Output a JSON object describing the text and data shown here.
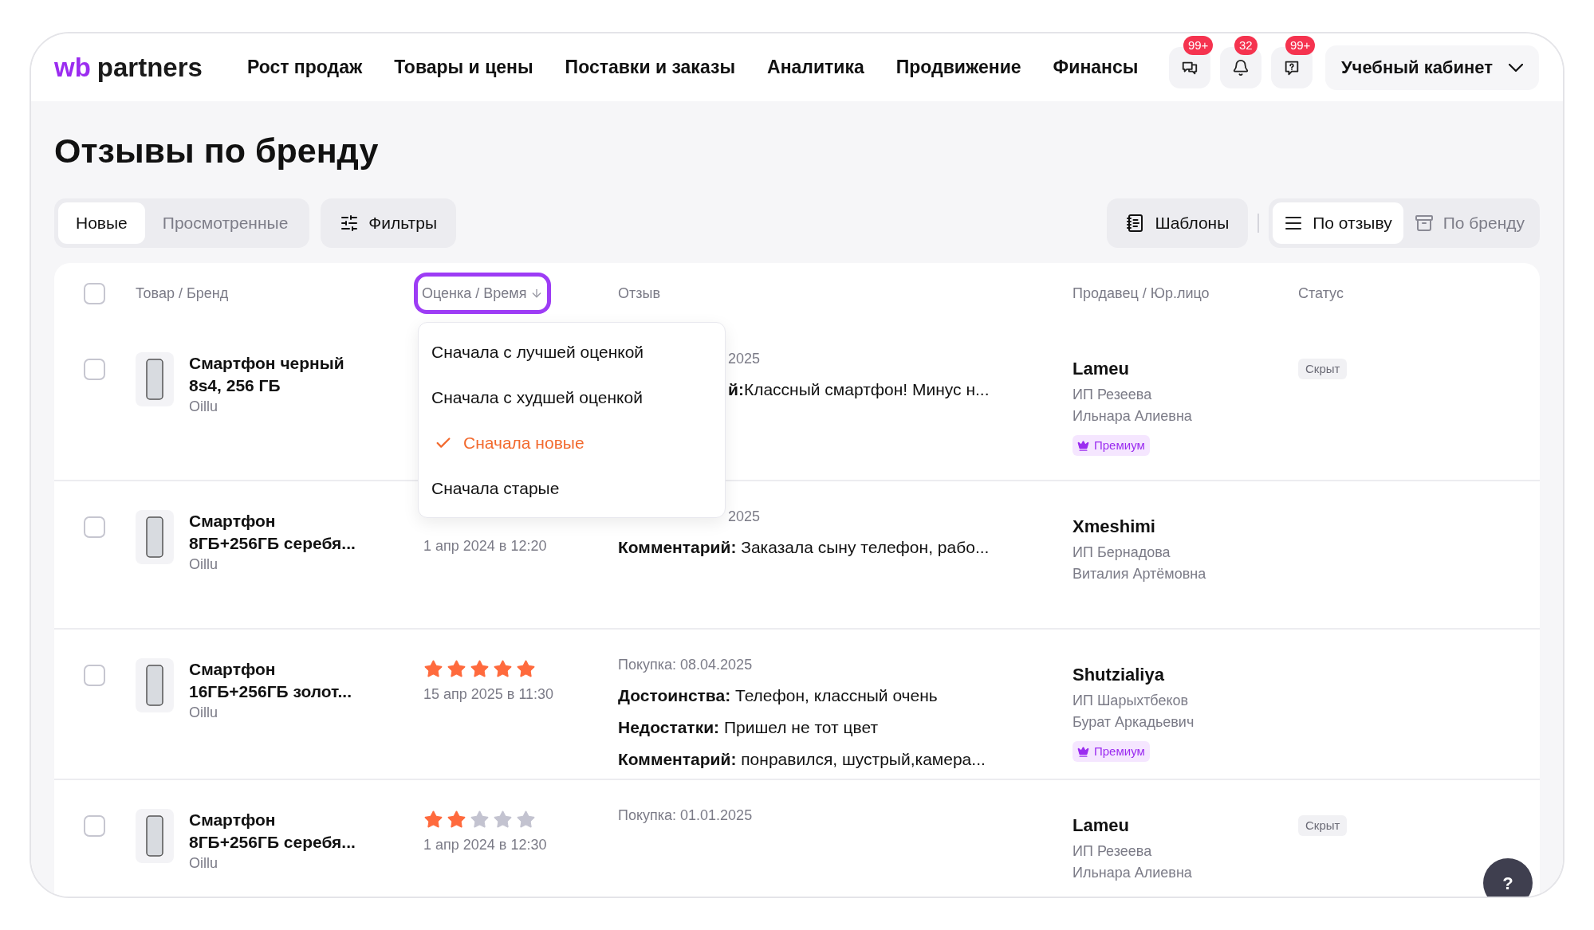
{
  "header": {
    "logo": {
      "mark": "wb",
      "text": "partners"
    },
    "nav": [
      "Рост продаж",
      "Товары и цены",
      "Поставки и заказы",
      "Аналитика",
      "Продвижение",
      "Финансы"
    ],
    "icon_buttons": [
      {
        "kind": "chat",
        "badge": "99+"
      },
      {
        "kind": "bell",
        "badge": "32"
      },
      {
        "kind": "help",
        "badge": "99+"
      }
    ],
    "account": "Учебный кабинет"
  },
  "title": "Отзывы по бренду",
  "tabs": [
    {
      "label": "Новые",
      "selected": true
    },
    {
      "label": "Просмотренные",
      "selected": false
    }
  ],
  "filters_button": "Фильтры",
  "templates_button": "Шаблоны",
  "view_tabs": [
    {
      "label": "По отзыву",
      "selected": true,
      "kind": "list"
    },
    {
      "label": "По бренду",
      "selected": false,
      "kind": "stack"
    }
  ],
  "table": {
    "select_all": {
      "checked": false
    },
    "columns": [
      {
        "label": "Товар / Бренд",
        "sorted": false,
        "highlighted": false
      },
      {
        "label": "Оценка / Время",
        "sorted": true,
        "highlighted": true
      },
      {
        "label": "Отзыв",
        "sorted": false,
        "highlighted": false
      },
      {
        "label": "Продавец / Юр.лицо",
        "sorted": false,
        "highlighted": false
      },
      {
        "label": "Статус",
        "sorted": false,
        "highlighted": false
      }
    ],
    "rows": [
      {
        "checked": false,
        "product": {
          "name": "Смартфон черный\n8s4, 256 ГБ",
          "brand": "Oillu"
        },
        "rating": {},
        "review": [
          {
            "kind": "purchase",
            "text": "2025",
            "covered": true
          },
          {
            "kind": "text",
            "text": "**й:**Классный смартфон! Минус н...",
            "covered": true
          }
        ],
        "seller": {
          "name": "Lameu",
          "entity": "ИП Резеева\nИльнара Алиевна",
          "premium": "Премиум"
        },
        "status": "Скрыт"
      },
      {
        "checked": false,
        "product": {
          "name": "Смартфон\n8ГБ+256ГБ серебя...",
          "brand": "Oillu"
        },
        "rating": {
          "time": "1 апр 2024 в 12:20"
        },
        "review": [
          {
            "kind": "purchase",
            "text": "2025",
            "covered": true
          },
          {
            "kind": "text",
            "text": "**Комментарий:** Заказала сыну телефон, рабо...",
            "covered": false
          }
        ],
        "seller": {
          "name": "Xmeshimi",
          "entity": "ИП Бернадова\nВиталия Артёмовна"
        }
      },
      {
        "checked": false,
        "product": {
          "name": "Смартфон\n16ГБ+256ГБ золот...",
          "brand": "Oillu"
        },
        "rating": {
          "stars": 5,
          "time": "15 апр 2025 в 11:30"
        },
        "review": [
          {
            "kind": "purchase",
            "text": "Покупка: 08.04.2025",
            "covered": false
          },
          {
            "kind": "text",
            "text": "**Достоинства:** Телефон, классный очень",
            "covered": false
          },
          {
            "kind": "text",
            "text": "**Недостатки:** Пришел не тот цвет",
            "covered": false
          },
          {
            "kind": "text",
            "text": "**Комментарий:** понравился, шустрый,камера...",
            "covered": false
          }
        ],
        "seller": {
          "name": "Shutzialiya",
          "entity": "ИП Шарыхтбеков\nБурат Аркадьевич",
          "premium": "Премиум"
        }
      },
      {
        "checked": false,
        "product": {
          "name": "Смартфон\n8ГБ+256ГБ серебя...",
          "brand": "Oillu"
        },
        "rating": {
          "stars": 2,
          "time": "1 апр 2024 в 12:30"
        },
        "review": [
          {
            "kind": "purchase",
            "text": "Покупка: 01.01.2025",
            "covered": false
          }
        ],
        "seller": {
          "name": "Lameu",
          "entity": "ИП Резеева\nИльнара Алиевна"
        },
        "status": "Скрыт"
      }
    ]
  },
  "sort_menu": [
    {
      "label": "Сначала с лучшей оценкой",
      "selected": false
    },
    {
      "label": "Сначала с худшей оценкой",
      "selected": false
    },
    {
      "label": "Сначала новые",
      "selected": true
    },
    {
      "label": "Сначала старые",
      "selected": false
    }
  ],
  "help_button": "?"
}
